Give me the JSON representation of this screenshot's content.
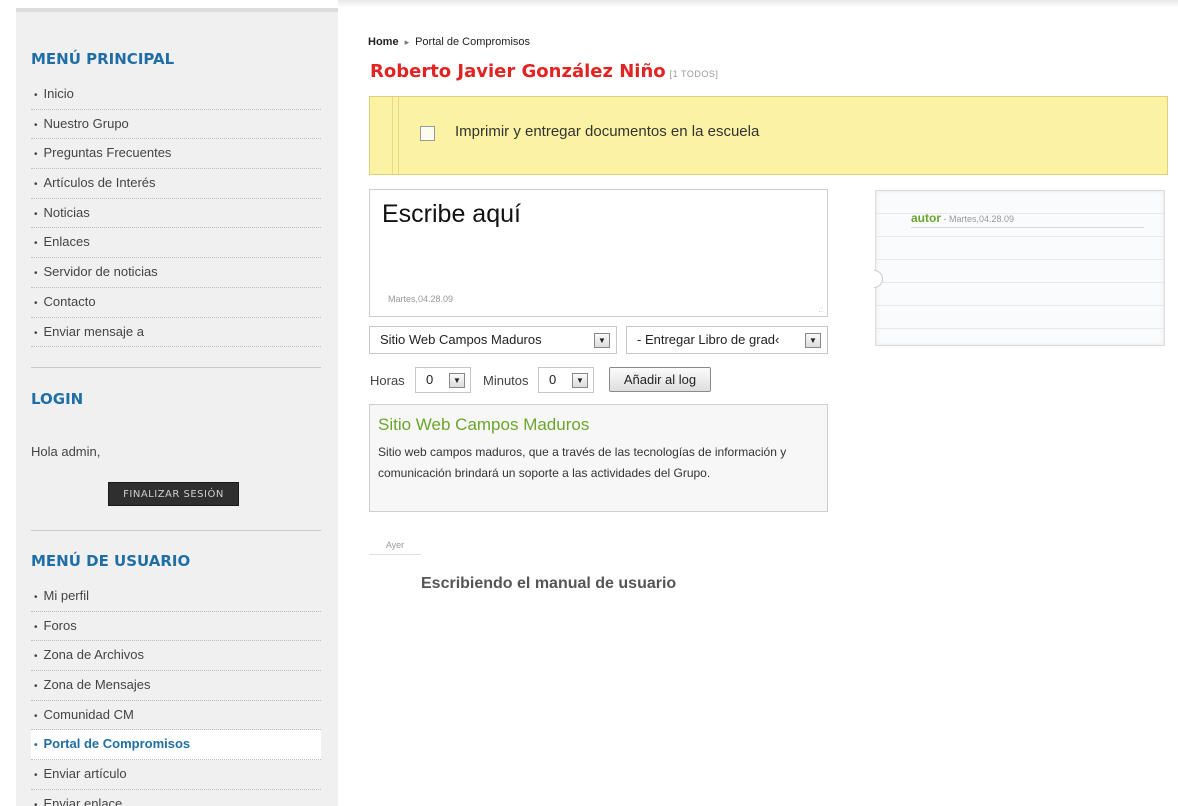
{
  "sidebar": {
    "menu_principal": {
      "heading": "MENÚ PRINCIPAL",
      "items": [
        "Inicio",
        "Nuestro Grupo",
        "Preguntas Frecuentes",
        "Artículos de Interés",
        "Noticias",
        "Enlaces",
        "Servidor de noticias",
        "Contacto",
        "Enviar mensaje a"
      ]
    },
    "login": {
      "heading": "LOGIN",
      "greeting": "Hola admin,",
      "logout_label": "FINALIZAR SESIÓN"
    },
    "menu_usuario": {
      "heading": "MENÚ DE USUARIO",
      "items": [
        "Mi perfil",
        "Foros",
        "Zona de Archivos",
        "Zona de Mensajes",
        "Comunidad CM",
        "Portal de Compromisos",
        "Enviar artículo",
        "Enviar enlace"
      ],
      "active_index": 5
    }
  },
  "breadcrumb": {
    "home": "Home",
    "separator": "▸",
    "current": "Portal de Compromisos"
  },
  "page": {
    "title": "Roberto Javier González Niño",
    "count": "[1 TODOS]"
  },
  "todo": {
    "text": "Imprimir y entregar documentos en la escuela",
    "checked": false
  },
  "note": {
    "text": "Escribe aquí",
    "date": "Martes,04.28.09",
    "grip": ".:"
  },
  "selects": {
    "project": "Sitio Web Campos Maduros",
    "task": "- Entregar Libro de grad‹",
    "arrow_glyph": "▼"
  },
  "log_form": {
    "hours_label": "Horas",
    "hours_value": "0",
    "minutes_label": "Minutos",
    "minutes_value": "0",
    "add_button": "Añadir al log"
  },
  "project": {
    "title": "Sitio Web Campos Maduros",
    "description": "Sitio web campos maduros, que a través de las tecnologías de información y comunicación brindará un soporte a las actividades del Grupo."
  },
  "log": {
    "day": "Ayer",
    "entry": "Escribiendo el manual de usuario"
  },
  "comment": {
    "author": "autor",
    "date": " - Martes,04.28.09"
  },
  "colors": {
    "heading_blue": "#1f6fa6",
    "title_red": "#e32222",
    "todo_yellow": "#fbf2a4",
    "green": "#6aa62a"
  }
}
